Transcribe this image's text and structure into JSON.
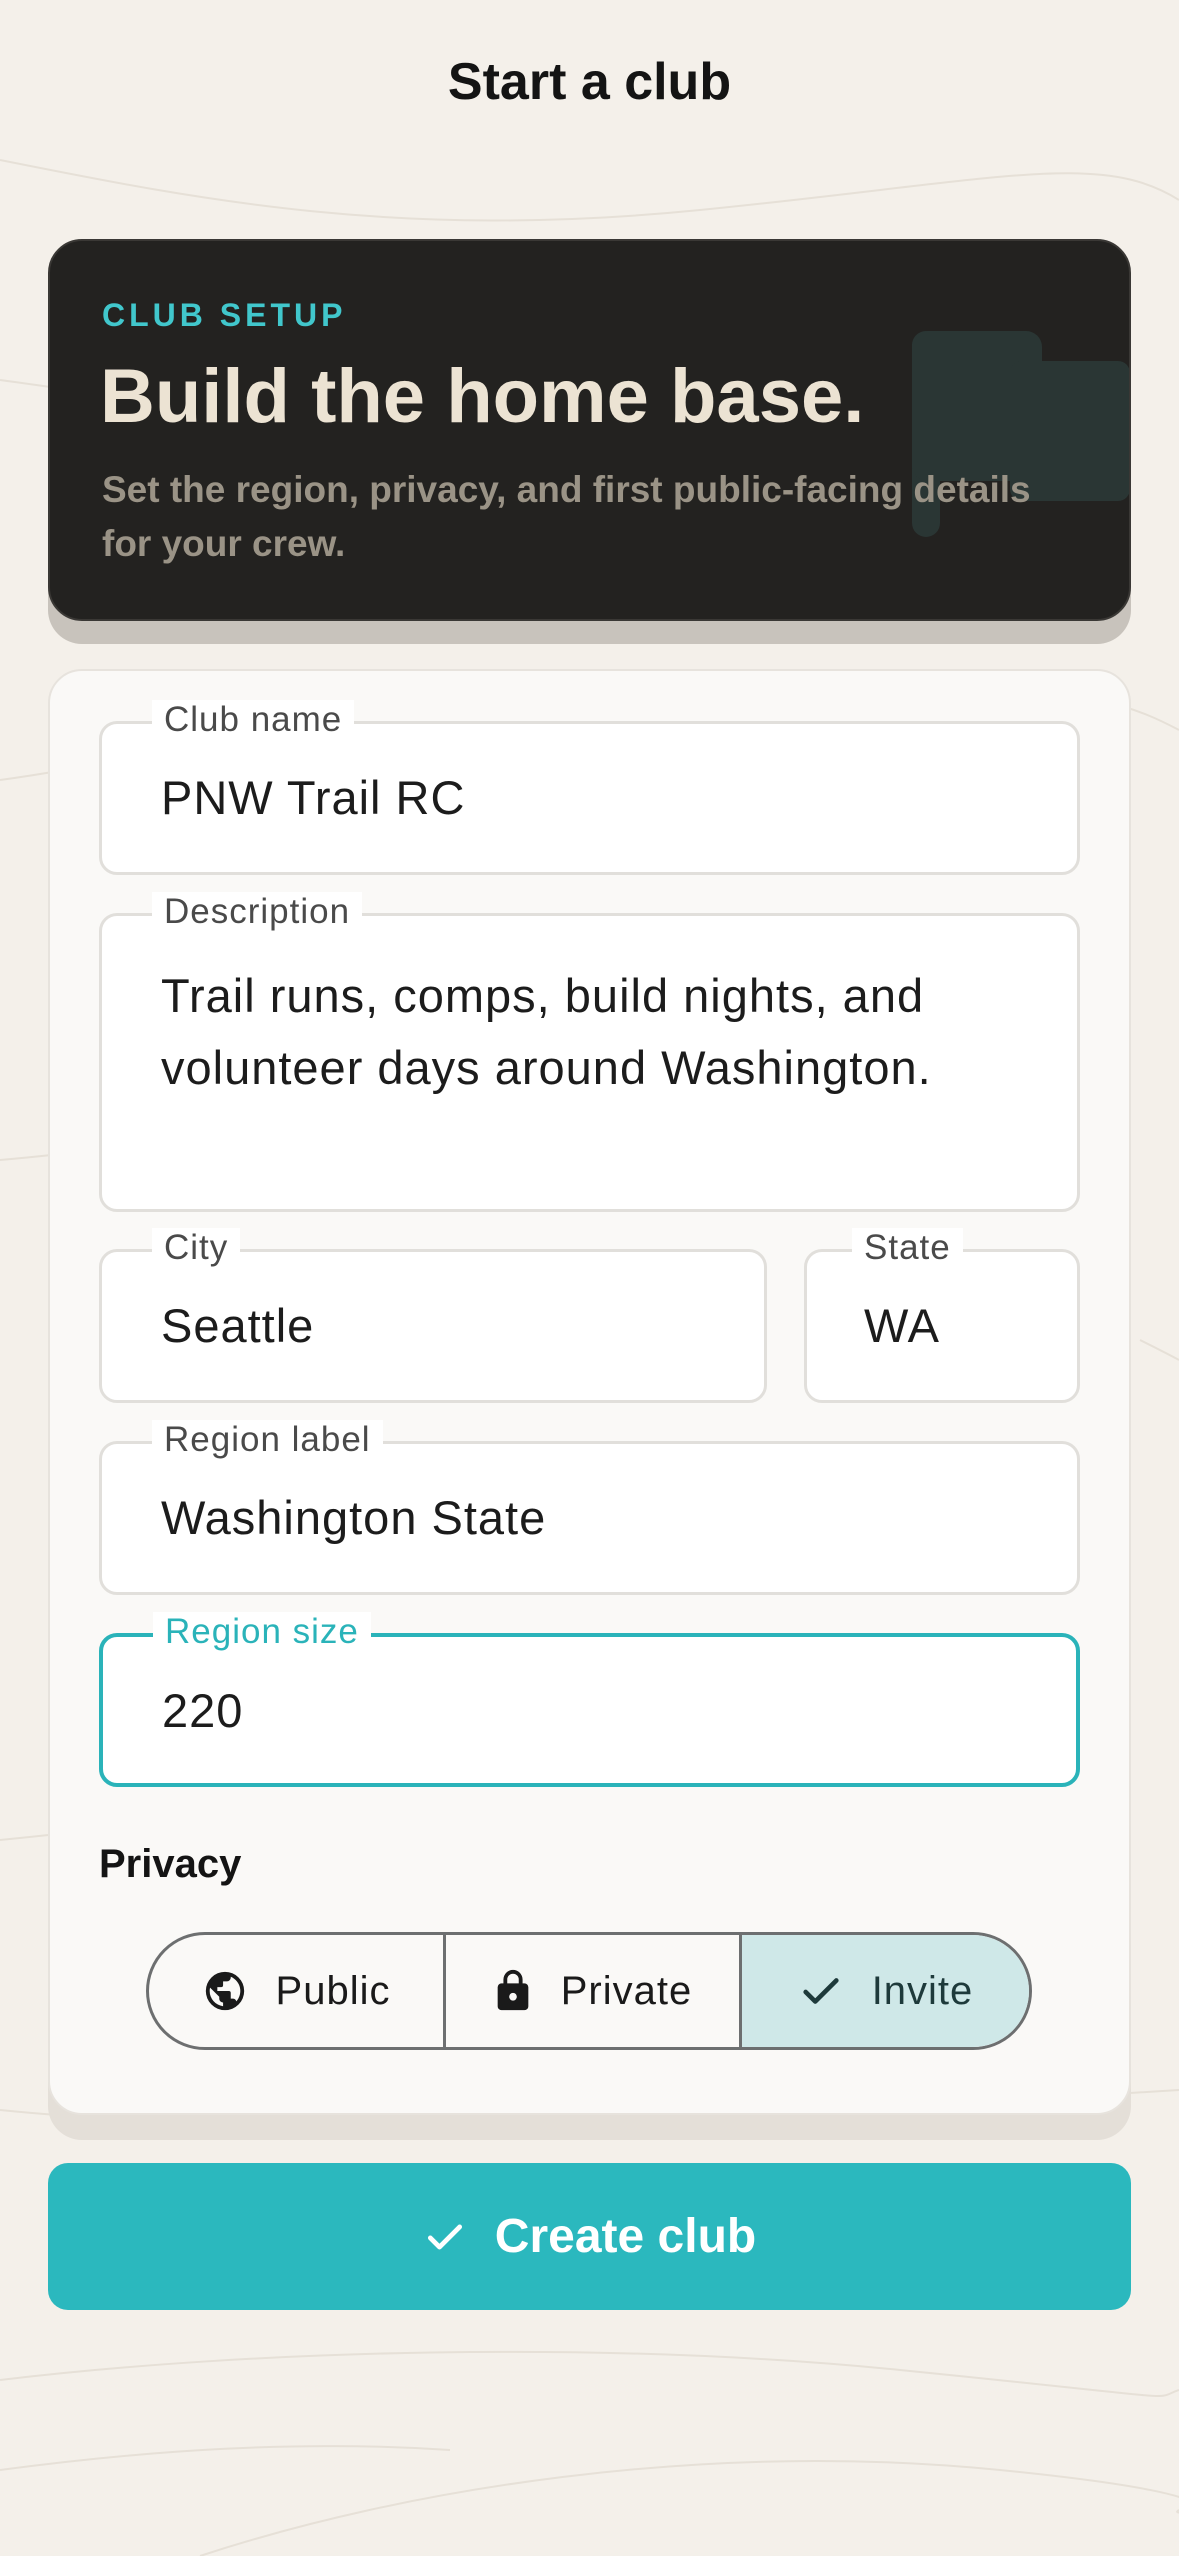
{
  "header": {
    "title": "Start a club"
  },
  "hero": {
    "eyebrow": "CLUB SETUP",
    "title": "Build the home base.",
    "subtitle": "Set the region, privacy, and first public-facing details for your crew.",
    "icon": "flag-icon"
  },
  "form": {
    "club_name": {
      "label": "Club name",
      "value": "PNW Trail RC"
    },
    "description": {
      "label": "Description",
      "value": "Trail runs, comps, build nights, and volunteer days around Washington."
    },
    "city": {
      "label": "City",
      "value": "Seattle"
    },
    "state": {
      "label": "State",
      "value": "WA"
    },
    "region_label": {
      "label": "Region label",
      "value": "Washington State"
    },
    "region_size": {
      "label": "Region size",
      "value": "220",
      "focused": true
    }
  },
  "privacy": {
    "heading": "Privacy",
    "options": [
      {
        "label": "Public",
        "icon": "globe-icon",
        "selected": false
      },
      {
        "label": "Private",
        "icon": "lock-icon",
        "selected": false
      },
      {
        "label": "Invite",
        "icon": "check-icon",
        "selected": true
      }
    ]
  },
  "actions": {
    "create_label": "Create club",
    "create_icon": "check-icon"
  },
  "colors": {
    "background": "#f4f0ea",
    "accent": "#2bb8be",
    "hero_bg": "#232220",
    "hero_eyebrow": "#41c7cc",
    "selected_segment": "#cfe8e8"
  }
}
